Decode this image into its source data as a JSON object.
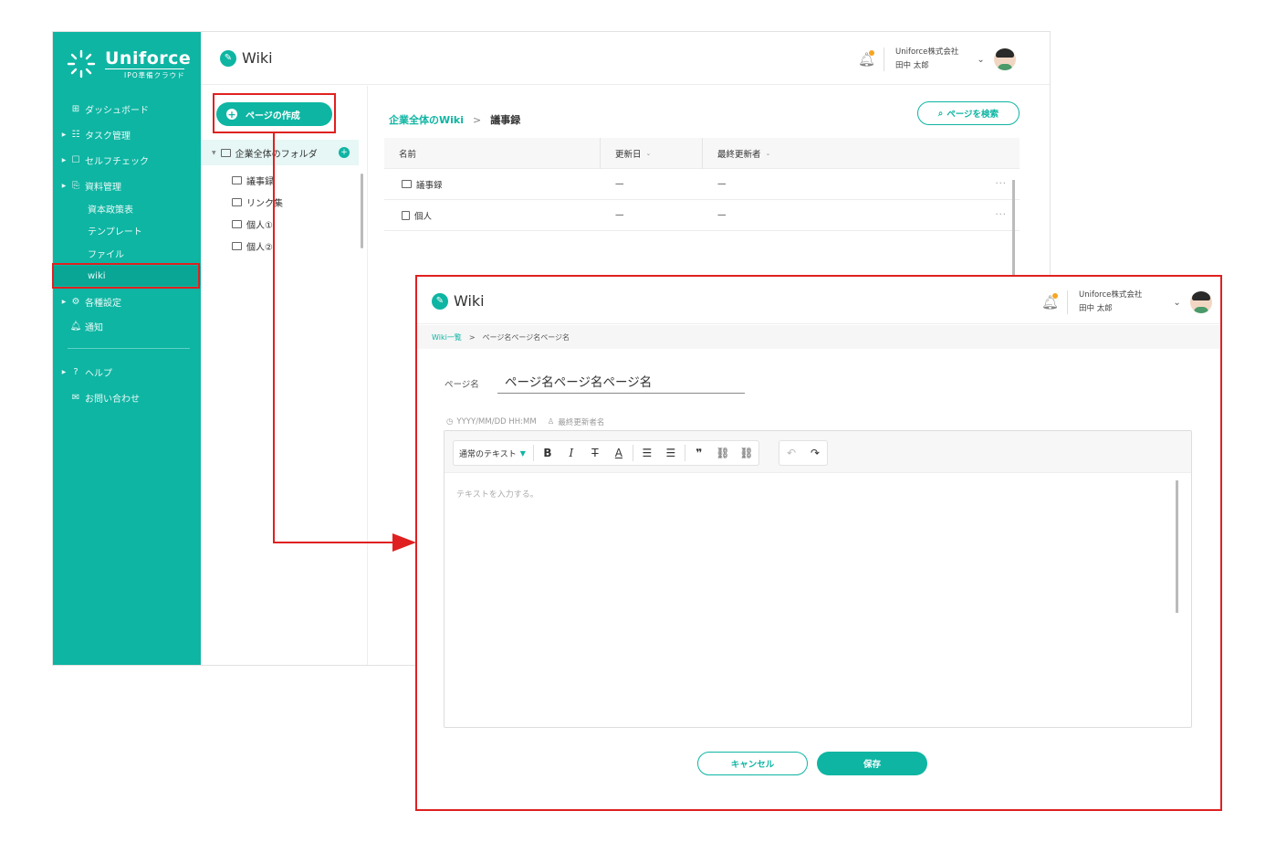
{
  "colors": {
    "brand": "#0eb5a3",
    "annotation": "#e02020",
    "notify_dot": "#f5a623"
  },
  "brand": {
    "name": "Uniforce",
    "tagline": "IPO準備クラウド"
  },
  "sidebar": {
    "items": [
      {
        "label": "ダッシュボード",
        "icon": "grid-icon"
      },
      {
        "label": "タスク管理",
        "icon": "task-icon"
      },
      {
        "label": "セルフチェック",
        "icon": "check-icon"
      },
      {
        "label": "資料管理",
        "icon": "document-icon"
      },
      {
        "label": "資本政策表"
      },
      {
        "label": "テンプレート"
      },
      {
        "label": "ファイル"
      },
      {
        "label": "wiki"
      },
      {
        "label": "各種設定",
        "icon": "gear-icon"
      },
      {
        "label": "通知",
        "icon": "bell-icon"
      },
      {
        "label": "ヘルプ",
        "icon": "help-icon"
      },
      {
        "label": "お問い合わせ",
        "icon": "mail-icon"
      }
    ]
  },
  "header": {
    "title": "Wiki",
    "company": "Uniforce株式会社",
    "user": "田中 太郎"
  },
  "tree": {
    "create_label": "ページの作成",
    "root": "企業全体のフォルダ",
    "folders": [
      "議事録",
      "リンク集",
      "個人①",
      "個人②"
    ]
  },
  "main": {
    "crumb_link": "企業全体のWiki",
    "crumb_sep": ">",
    "crumb_current": "議事録",
    "search_label": "ページを検索",
    "columns": [
      "名前",
      "更新日",
      "最終更新者"
    ],
    "rows": [
      {
        "name": "議事録",
        "date": "—",
        "editor": "—",
        "more": "···"
      },
      {
        "name": "個人",
        "date": "—",
        "editor": "—",
        "more": "···"
      }
    ]
  },
  "editor_page": {
    "title": "Wiki",
    "company": "Uniforce株式会社",
    "user": "田中 太郎",
    "crumb_link": "Wiki一覧",
    "crumb_sep": ">",
    "crumb_current": "ページ名ページ名ページ名",
    "page_name_label": "ページ名",
    "page_name_value": "ページ名ページ名ページ名",
    "meta_date": "YYYY/MM/DD HH:MM",
    "meta_editor": "最終更新者名",
    "text_style": "通常のテキスト",
    "body_placeholder": "テキストを入力する。",
    "cancel_label": "キャンセル",
    "save_label": "保存"
  }
}
